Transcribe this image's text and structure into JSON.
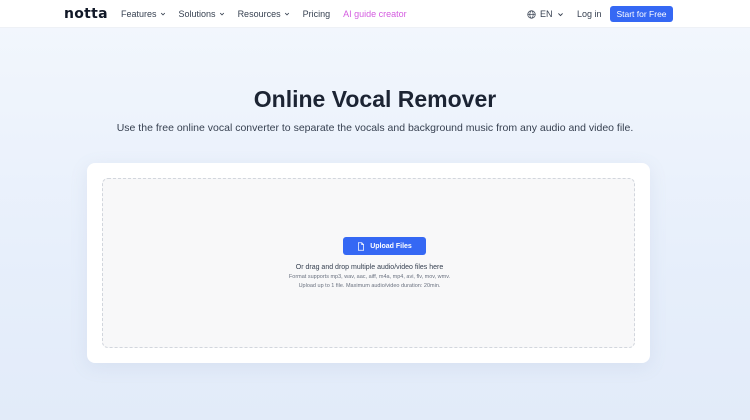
{
  "header": {
    "logo": "notta",
    "nav": [
      {
        "label": "Features",
        "has_dropdown": true
      },
      {
        "label": "Solutions",
        "has_dropdown": true
      },
      {
        "label": "Resources",
        "has_dropdown": true
      },
      {
        "label": "Pricing",
        "has_dropdown": false
      },
      {
        "label": "AI guide creator",
        "has_dropdown": false
      }
    ],
    "language": "EN",
    "login": "Log in",
    "cta": "Start for Free"
  },
  "hero": {
    "title": "Online Vocal Remover",
    "subtitle": "Use the free online vocal converter to separate the vocals and background music from any audio and video file."
  },
  "upload": {
    "button_label": "Upload Files",
    "drag_text": "Or drag and drop multiple audio/video files here",
    "formats_text": "Format supports mp3, wav, aac, aiff, m4a, mp4, avi, flv, mov, wmv.",
    "limit_text": "Upload up to 1 file. Maximum audio/video duration: 20min."
  },
  "colors": {
    "primary": "#3568f4",
    "accent": "#d45ce0",
    "text": "#1c2433"
  },
  "icons": {
    "nav_dropdown": "chevron-down-icon",
    "language": "globe-icon",
    "upload": "file-icon"
  }
}
